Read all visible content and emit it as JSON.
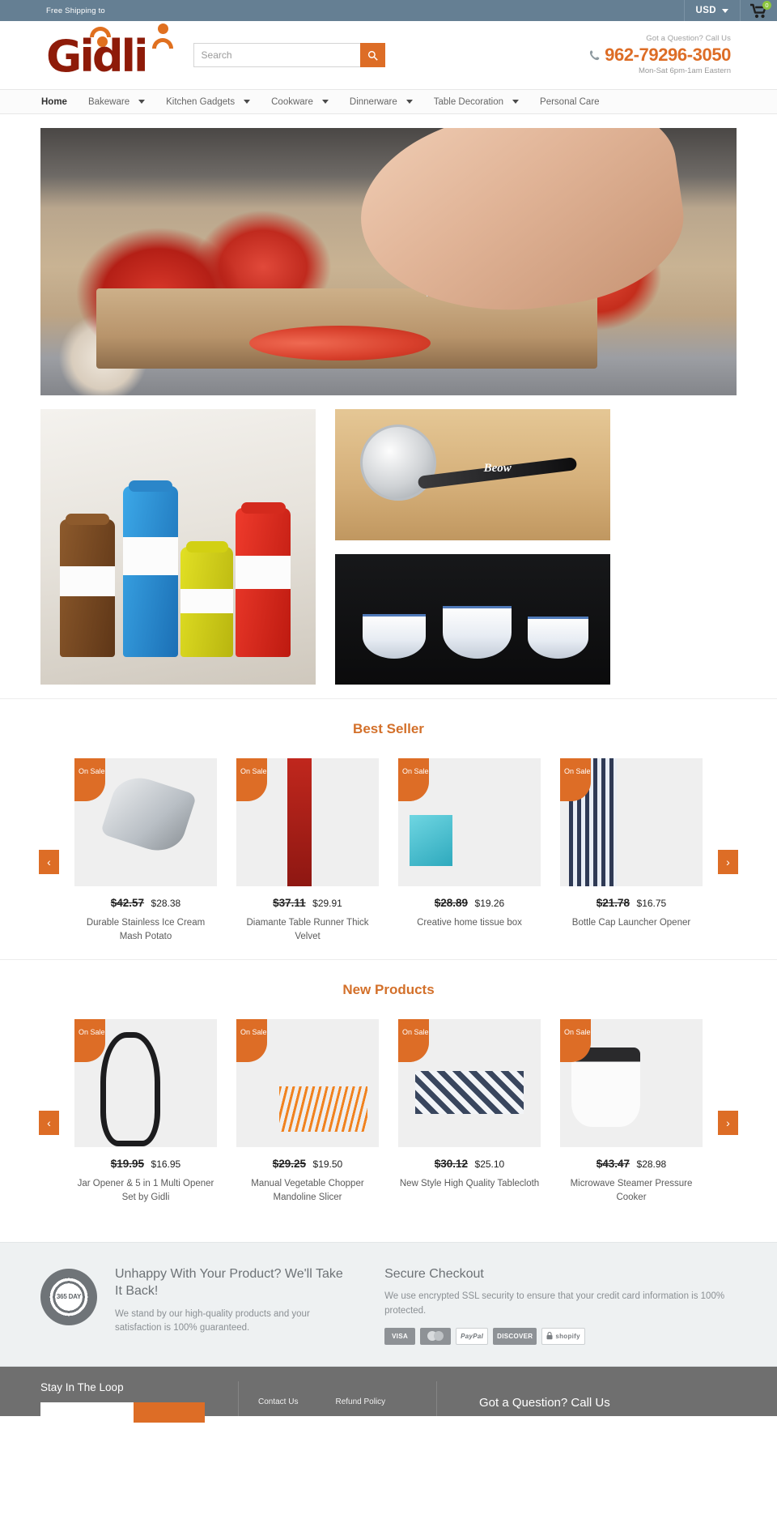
{
  "topbar": {
    "shipping_text": "Free Shipping to",
    "currency": "USD",
    "cart_count": "0"
  },
  "header": {
    "logo_text": "Gidli",
    "search_placeholder": "Search",
    "search_value": "",
    "call_question": "Got a Question? Call Us",
    "phone": "962-79296-3050",
    "hours": "Mon-Sat 6pm-1am Eastern"
  },
  "nav": {
    "items": [
      {
        "label": "Home",
        "has_dropdown": false,
        "active": true
      },
      {
        "label": "Bakeware",
        "has_dropdown": true,
        "active": false
      },
      {
        "label": "Kitchen Gadgets",
        "has_dropdown": true,
        "active": false
      },
      {
        "label": "Cookware",
        "has_dropdown": true,
        "active": false
      },
      {
        "label": "Dinnerware",
        "has_dropdown": true,
        "active": false
      },
      {
        "label": "Table Decoration",
        "has_dropdown": true,
        "active": false
      },
      {
        "label": "Personal Care",
        "has_dropdown": false,
        "active": false
      }
    ]
  },
  "sections": [
    {
      "title": "Best Seller",
      "prev_label": "‹",
      "next_label": "›",
      "products": [
        {
          "badge": "On Sale",
          "price_old": "$42.57",
          "price_new": "$28.38",
          "title": "Durable Stainless Ice Cream Mash Potato"
        },
        {
          "badge": "On Sale",
          "price_old": "$37.11",
          "price_new": "$29.91",
          "title": "Diamante Table Runner Thick Velvet"
        },
        {
          "badge": "On Sale",
          "price_old": "$28.89",
          "price_new": "$19.26",
          "title": "Creative home tissue box"
        },
        {
          "badge": "On Sale",
          "price_old": "$21.78",
          "price_new": "$16.75",
          "title": "Bottle Cap Launcher Opener"
        }
      ]
    },
    {
      "title": "New Products",
      "prev_label": "‹",
      "next_label": "›",
      "products": [
        {
          "badge": "On Sale",
          "price_old": "$19.95",
          "price_new": "$16.95",
          "title": "Jar Opener & 5 in 1 Multi Opener Set by Gidli"
        },
        {
          "badge": "On Sale",
          "price_old": "$29.25",
          "price_new": "$19.50",
          "title": "Manual Vegetable Chopper Mandoline Slicer"
        },
        {
          "badge": "On Sale",
          "price_old": "$30.12",
          "price_new": "$25.10",
          "title": "New Style High Quality Tablecloth"
        },
        {
          "badge": "On Sale",
          "price_old": "$43.47",
          "price_new": "$28.98",
          "title": "Microwave Steamer Pressure Cooker"
        }
      ]
    }
  ],
  "trust": {
    "seal_text": "365 DAY",
    "guarantee_heading": "Unhappy With Your Product? We'll Take It Back!",
    "guarantee_body": "We stand by our high-quality products and your satisfaction is 100% guaranteed.",
    "secure_heading": "Secure Checkout",
    "secure_body": "We use encrypted SSL security to ensure that your credit card information is 100% protected.",
    "payment_badges": [
      "VISA",
      "MasterCard",
      "PayPal",
      "DISCOVER",
      "shopify"
    ]
  },
  "footer": {
    "newsletter_heading": "Stay In The Loop",
    "email_placeholder": "",
    "signup_label": "",
    "links": [
      "Contact Us",
      "Refund Policy"
    ],
    "call_heading": "Got a Question? Call Us"
  },
  "colors": {
    "accent_orange": "#dd6d26",
    "brand_maroon": "#8e1b09",
    "topbar_blue": "#657f93",
    "section_title": "#d3702a",
    "badge_green": "#8cc63f"
  }
}
